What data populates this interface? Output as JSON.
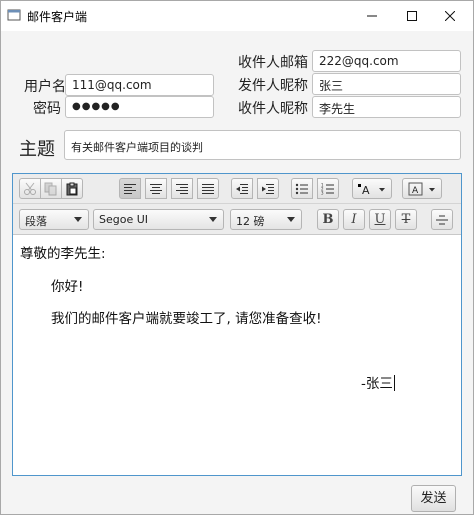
{
  "window": {
    "title": "邮件客户端"
  },
  "form": {
    "username_label": "用户名",
    "username_value": "111@qq.com",
    "password_label": "密码",
    "password_value": "●●●●●",
    "recipient_email_label": "收件人邮箱",
    "recipient_email_value": "222@qq.com",
    "sender_nickname_label": "发件人昵称",
    "sender_nickname_value": "张三",
    "recipient_nickname_label": "收件人昵称",
    "recipient_nickname_value": "李先生",
    "subject_label": "主题",
    "subject_value": "有关邮件客户端项目的谈判"
  },
  "toolbar": {
    "paragraph_combo": "段落",
    "font_combo": "Segoe UI",
    "size_combo": "12 磅",
    "bold": "B",
    "italic": "I",
    "underline": "U",
    "strike": "T"
  },
  "body": {
    "greeting": "尊敬的李先生:",
    "hello": "你好!",
    "message": "我们的邮件客户端就要竣工了, 请您准备查收!",
    "signature": "-张三"
  },
  "send_button": "发送"
}
